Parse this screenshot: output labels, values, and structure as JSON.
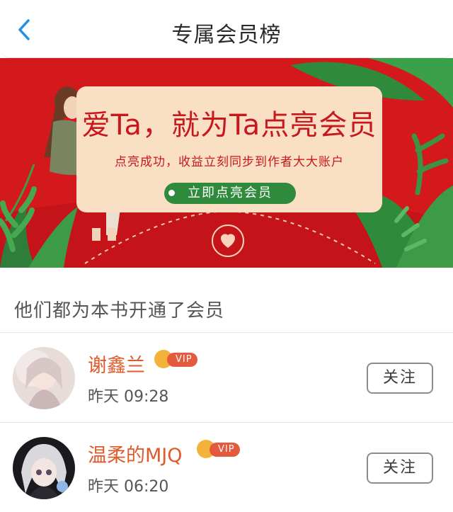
{
  "header": {
    "back_icon": "chevron-left-icon",
    "title": "专属会员榜"
  },
  "banner": {
    "headline": "爱Ta，就为Ta点亮会员",
    "subline": "点亮成功，收益立刻同步到作者大大账户",
    "cta_label": "立即点亮会员",
    "colors": {
      "background": "#d4191c",
      "card": "#f9e0c5",
      "cta": "#2f8a3c"
    }
  },
  "list": {
    "title": "他们都为本书开通了会员",
    "members": [
      {
        "name": "谢鑫兰",
        "badge": "VIP",
        "time": "昨天 09:28",
        "follow_label": "关注"
      },
      {
        "name": "温柔的MJQ",
        "badge": "VIP",
        "time": "昨天 06:20",
        "follow_label": "关注"
      }
    ]
  },
  "colors": {
    "accent_name": "#e05a2b",
    "back_icon": "#1e90e8"
  }
}
